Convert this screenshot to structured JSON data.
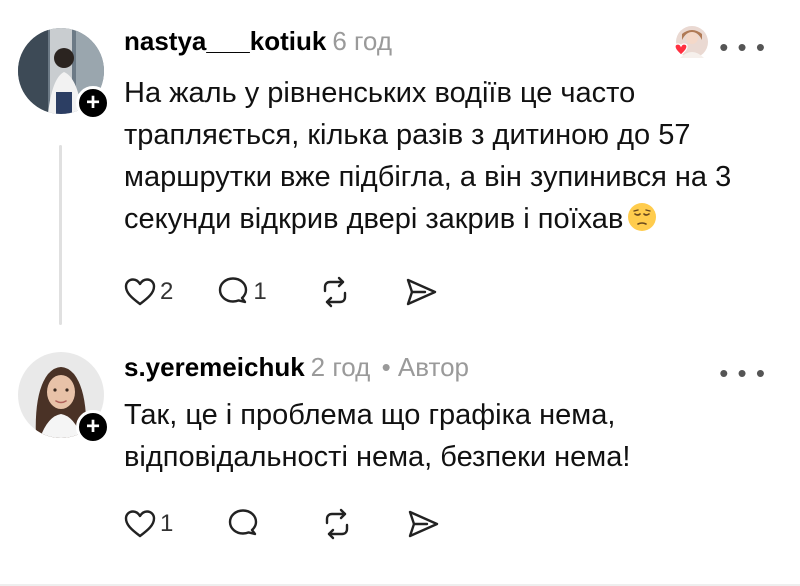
{
  "comments": [
    {
      "username": "nastya___kotiuk",
      "time": "6 год",
      "author_tag": "",
      "text": "На жаль у рівненських водіїв це часто трапляється, кілька разів з дитиною до 57 маршрутки вже підбігла, а він зупинився на 3 секунди відкрив двері закрив і поїхав",
      "emoji": "pensive-face",
      "likes": "2",
      "replies": "1",
      "liked_by_author": true
    },
    {
      "username": "s.yeremeichuk",
      "time": "2 год",
      "author_tag": "• Автор",
      "text": "Так, це і проблема що графіка нема, відповідальності нема, безпеки нема!",
      "likes": "1",
      "replies": ""
    }
  ],
  "icons": {
    "like": "heart-outline-icon",
    "reply": "speech-bubble-icon",
    "repost": "repost-arrows-icon",
    "share": "send-icon",
    "more": "more-dots-icon",
    "follow": "plus-icon"
  },
  "colors": {
    "meta_gray": "#9a9a9a",
    "heart_red": "#ff3040",
    "icon_dark": "#222222"
  }
}
